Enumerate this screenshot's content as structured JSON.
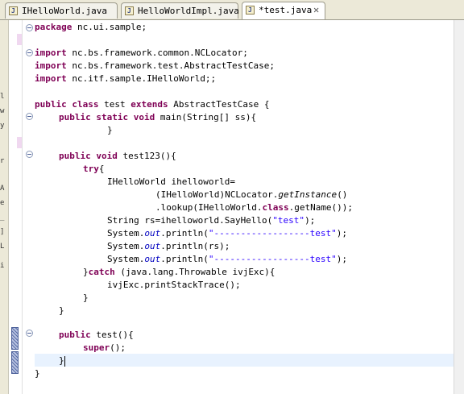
{
  "tabs": [
    {
      "label": "IHelloWorld.java",
      "active": false
    },
    {
      "label": "HelloWorldImpl.java",
      "active": false
    },
    {
      "label": "*test.java",
      "active": true,
      "close": "✕"
    }
  ],
  "code": {
    "package_kw": "package",
    "package_name": " nc.ui.sample;",
    "import_kw": "import",
    "import1": " nc.bs.framework.common.NCLocator;",
    "import2": " nc.bs.framework.test.AbstractTestCase;",
    "import3": " nc.itf.sample.IHelloWorld;;",
    "public_kw": "public",
    "class_kw": " class",
    "class_name": " test ",
    "extends_kw": "extends",
    "class_rest": " AbstractTestCase {",
    "static_kw": " static",
    "void_kw": " void",
    "main_sig": " main(String[] ss){",
    "close_brace": "}",
    "test123_sig": " test123(){",
    "try_kw": "try",
    "try_rest": "{",
    "decl": "IHelloWorld ihelloworld=",
    "cast": "(IHelloWorld)NCLocator.",
    "getInstance": "getInstance",
    "cast_end": "()",
    "lookup_start": ".lookup(IHelloWorld.",
    "class_kw2": "class",
    "lookup_end": ".getName());",
    "string_decl": "String rs=ihelloworld.SayHello(",
    "str_test": "\"test\"",
    "string_end": ");",
    "sysout_pre": "System.",
    "out": "out",
    "println": ".println(",
    "dash_str": "\"------------------test\"",
    "println_end": ");",
    "println_rs": ".println(rs);",
    "catch_pre": "}",
    "catch_kw": "catch",
    "catch_rest": " (java.lang.Throwable ivjExc){",
    "stacktrace": "ivjExc.printStackTrace();",
    "test_sig": " test(){",
    "super_kw": "super",
    "super_rest": "();"
  },
  "left_strip_chars": [
    "l",
    "w",
    "y",
    "r",
    "A",
    "e",
    "_",
    "]",
    "L",
    "i"
  ]
}
